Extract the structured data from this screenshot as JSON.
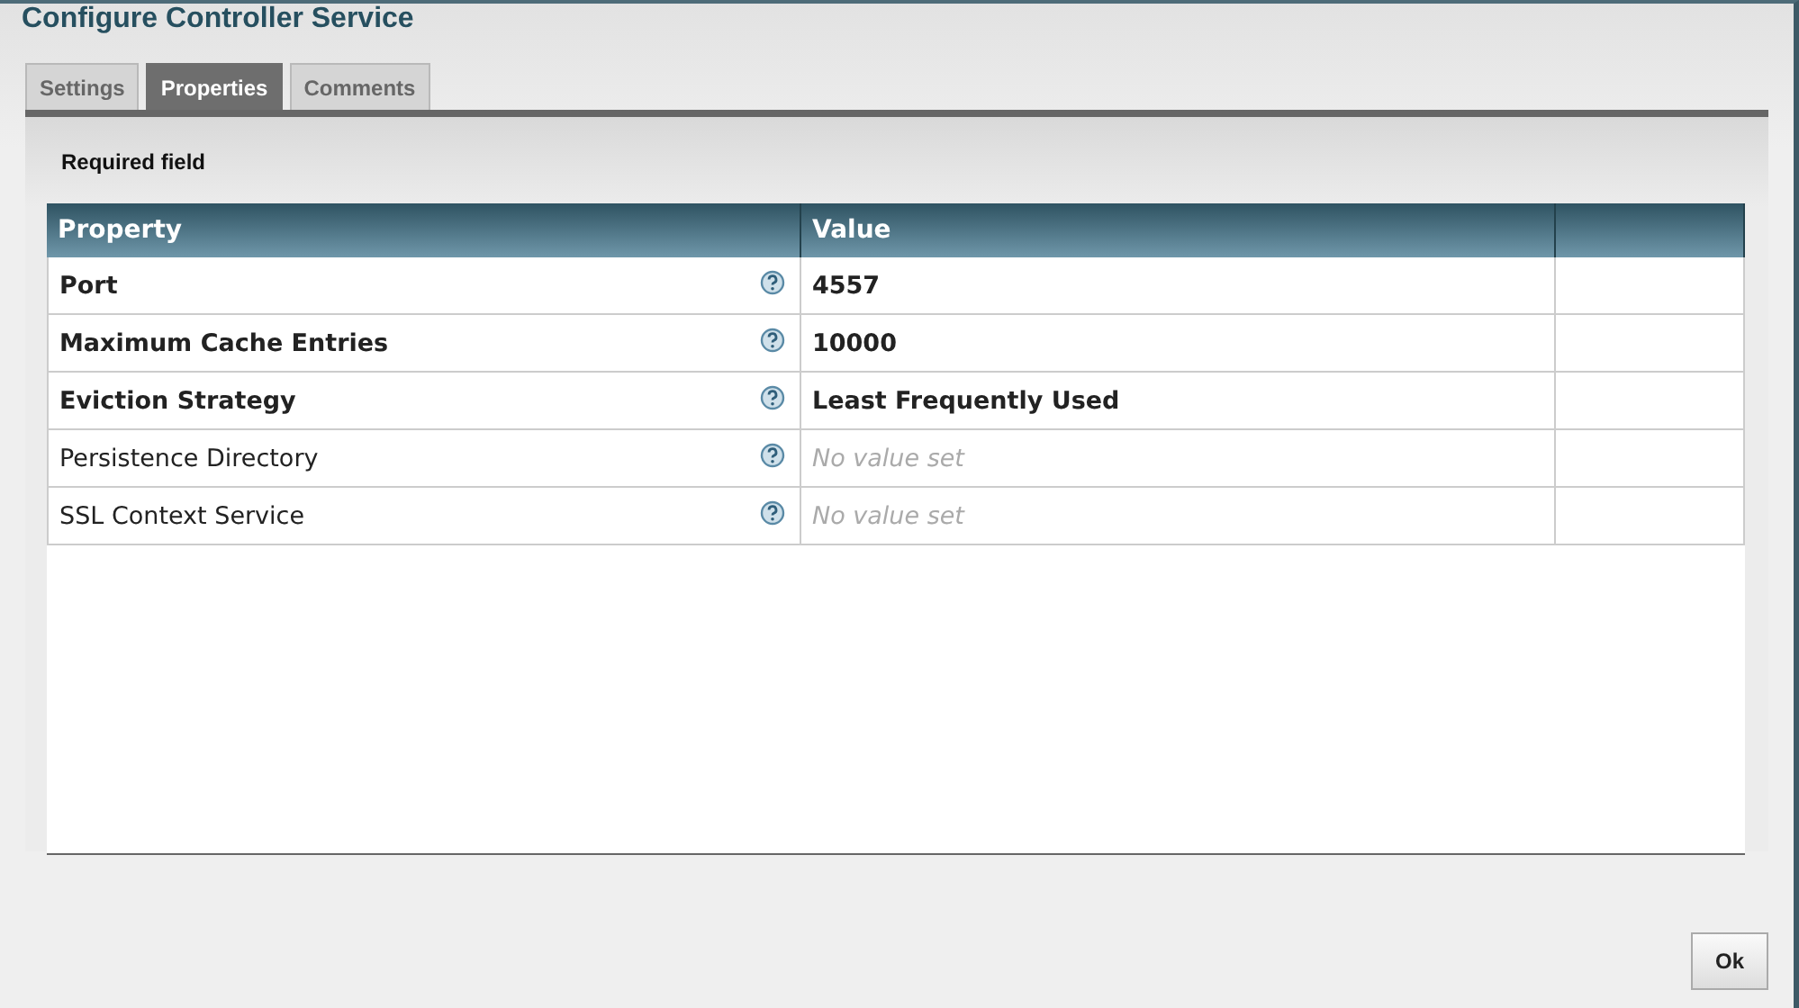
{
  "dialog": {
    "title": "Configure Controller Service"
  },
  "tabs": [
    {
      "label": "Settings",
      "selected": false
    },
    {
      "label": "Properties",
      "selected": true
    },
    {
      "label": "Comments",
      "selected": false
    }
  ],
  "required_note": "Required field",
  "table": {
    "columns": [
      "Property",
      "Value"
    ],
    "rows": [
      {
        "property": "Port",
        "required": true,
        "value": "4557"
      },
      {
        "property": "Maximum Cache Entries",
        "required": true,
        "value": "10000"
      },
      {
        "property": "Eviction Strategy",
        "required": true,
        "value": "Least Frequently Used"
      },
      {
        "property": "Persistence Directory",
        "required": false,
        "placeholder": "No value set"
      },
      {
        "property": "SSL Context Service",
        "required": false,
        "placeholder": "No value set"
      }
    ]
  },
  "buttons": [
    "Ok"
  ]
}
